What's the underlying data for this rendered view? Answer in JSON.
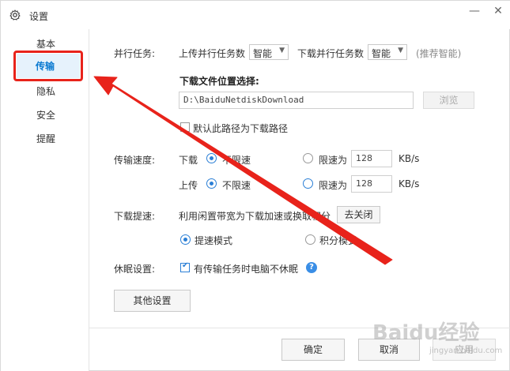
{
  "window": {
    "title": "设置",
    "controls": {
      "minimize": "—",
      "close": "✕"
    }
  },
  "sidebar": {
    "items": [
      {
        "label": "基本",
        "active": false
      },
      {
        "label": "传输",
        "active": true
      },
      {
        "label": "隐私",
        "active": false
      },
      {
        "label": "安全",
        "active": false
      },
      {
        "label": "提醒",
        "active": false
      }
    ]
  },
  "parallel": {
    "section_label": "并行任务:",
    "upload_label": "上传并行任务数",
    "upload_value": "智能",
    "download_label": "下载并行任务数",
    "download_value": "智能",
    "hint": "(推荐智能)"
  },
  "download_location": {
    "label": "下载文件位置选择:",
    "path": "D:\\BaiduNetdiskDownload",
    "browse_label": "浏览",
    "default_checkbox_label": "默认此路径为下载路径",
    "default_checked": false
  },
  "speed": {
    "section_label": "传输速度:",
    "download_label": "下载",
    "upload_label": "上传",
    "unlimited_label": "不限速",
    "limit_label": "限速为",
    "download_limit_value": "128",
    "upload_limit_value": "128",
    "unit": "KB/s"
  },
  "boost": {
    "section_label": "下载提速:",
    "description": "利用闲置带宽为下载加速或换取积分",
    "close_button": "去关闭",
    "mode_boost": "提速模式",
    "mode_points": "积分模式"
  },
  "sleep": {
    "section_label": "休眠设置:",
    "checkbox_label": "有传输任务时电脑不休眠",
    "checked": true
  },
  "other_settings_button": "其他设置",
  "footer": {
    "ok": "确定",
    "cancel": "取消",
    "apply": "应用"
  },
  "watermark": {
    "text": "Baidu经验",
    "sub": "jingyan.baidu.com"
  },
  "colors": {
    "accent": "#2b7fd6",
    "annotation_red": "#e8231b"
  }
}
